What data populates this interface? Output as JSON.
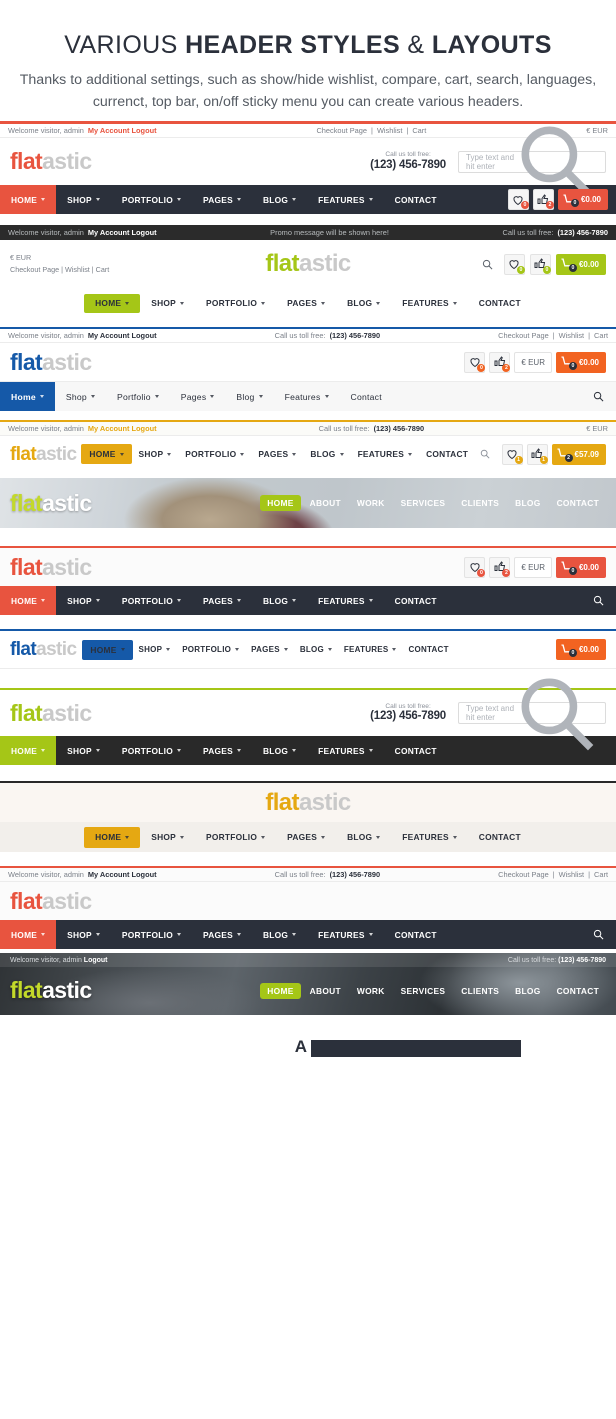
{
  "intro": {
    "title_light": "VARIOUS ",
    "title_bold_1": "HEADER STYLES",
    "title_amp": " & ",
    "title_bold_2": "LAYOUTS",
    "subtitle_line1": "Thanks to additional settings, such as show/hide wishlist, compare, cart, search, languages,",
    "subtitle_line2": "currenct, top bar, on/off sticky menu you can create various headers."
  },
  "common": {
    "welcome": "Welcome visitor, admin",
    "account_logout": "My Account Logout",
    "logout_only": "Logout",
    "checkout": "Checkout Page",
    "wishlist": "Wishlist",
    "cart": "Cart",
    "divider": "|",
    "currency": "€ EUR",
    "call_label": "Call us toll free:",
    "phone": "(123) 456-7890",
    "call_inline": "Call us toll free:",
    "promo": "Promo message will be shown here!",
    "search_placeholder": "Type text and hit enter",
    "logo_a": "flat",
    "logo_b": "astic",
    "menu": [
      "HOME",
      "SHOP",
      "PORTFOLIO",
      "PAGES",
      "BLOG",
      "FEATURES",
      "CONTACT"
    ],
    "menu_mixed": [
      "Home",
      "Shop",
      "Portfolio",
      "Pages",
      "Blog",
      "Features",
      "Contact"
    ],
    "menu_onepage": [
      "HOME",
      "ABOUT",
      "WORK",
      "SERVICES",
      "CLIENTS",
      "BLOG",
      "CONTACT"
    ]
  },
  "colors": {
    "red": "#e8543f",
    "red_dark": "#e04a32",
    "green": "#a5c617",
    "blue": "#1559a8",
    "orange": "#f26321",
    "yellow": "#e5a812",
    "dark": "#2b303b",
    "black": "#292929",
    "grey_logo": "#c9c9c9"
  },
  "headers": [
    {
      "id": "header-1-classic-red",
      "accent": "#e8543f",
      "topline": "#e8543f",
      "topbar_bg": "#ffffff",
      "nav_style": "dark",
      "wishlist_count": "0",
      "compare_count": "2",
      "cart_count": "0",
      "cart_total": "€0.00"
    },
    {
      "id": "header-2-centered-green",
      "accent": "#a5c617",
      "topbar_bg": "#2b2b2b",
      "wishlist_count": "0",
      "compare_count": "0",
      "cart_count": "0",
      "cart_total": "€0.00"
    },
    {
      "id": "header-3-blue",
      "accent": "#1559a8",
      "cart_color": "#f26321",
      "wishlist_count": "0",
      "compare_count": "2",
      "cart_count": "0",
      "cart_total": "€0.00"
    },
    {
      "id": "header-4-yellow-inline",
      "accent": "#e5a812",
      "topline": "#e5a812",
      "wishlist_count": "1",
      "compare_count": "1",
      "cart_count": "2",
      "cart_total": "€57.09"
    },
    {
      "id": "header-5-photo-light-green",
      "accent": "#a5c617"
    },
    {
      "id": "header-6-red-darknav",
      "accent": "#e8543f",
      "topline": "#e8543f",
      "wishlist_count": "0",
      "compare_count": "2",
      "cart_count": "0",
      "cart_total": "€0.00"
    },
    {
      "id": "header-7-blue-compact",
      "accent": "#1559a8",
      "topline": "#1559a8",
      "cart_color": "#f26321",
      "cart_count": "0",
      "cart_total": "€0.00"
    },
    {
      "id": "header-8-green-blacknav",
      "accent": "#a5c617",
      "topline": "#a5c617"
    },
    {
      "id": "header-9-centered-yellow",
      "accent": "#e5a812",
      "topline": "#292929"
    },
    {
      "id": "header-10-red-search",
      "accent": "#e8543f",
      "topline": "#e8543f"
    },
    {
      "id": "header-11-photo-dark-green",
      "accent": "#a5c617"
    }
  ],
  "footer": {
    "text": "A                                    s"
  }
}
